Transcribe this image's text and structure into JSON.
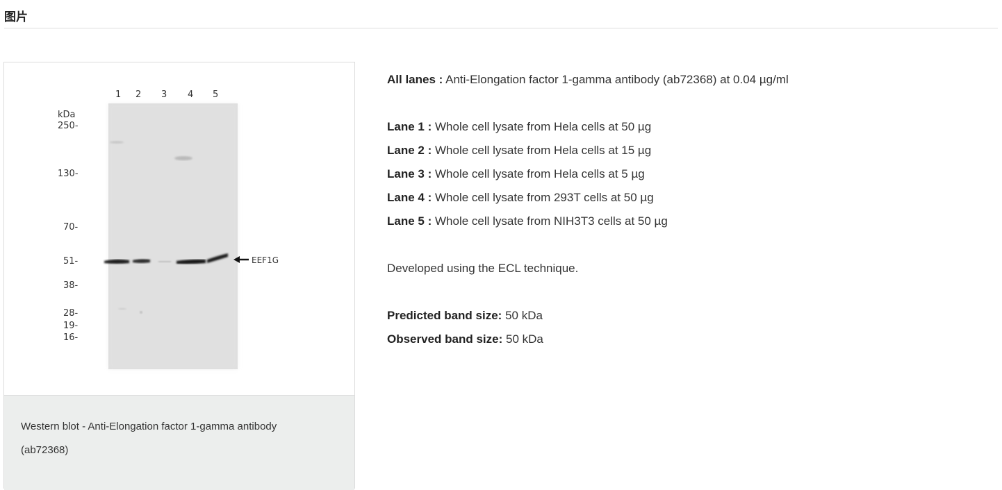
{
  "section": {
    "title": "图片"
  },
  "figure": {
    "lane_numbers": [
      "1",
      "2",
      "3",
      "4",
      "5"
    ],
    "unit_label": "kDa",
    "markers": [
      "250",
      "130",
      "70",
      "51",
      "38",
      "28",
      "19",
      "16"
    ],
    "band_label": "EEF1G",
    "caption": "Western blot - Anti-Elongation factor 1-gamma antibody (ab72368)"
  },
  "info": {
    "all_lanes_label": "All lanes :",
    "all_lanes_text": "Anti-Elongation factor 1-gamma antibody (ab72368) at 0.04 µg/ml",
    "lanes": [
      {
        "label": "Lane 1 :",
        "text": "Whole cell lysate from Hela cells at 50 µg"
      },
      {
        "label": "Lane 2 :",
        "text": "Whole cell lysate from Hela cells at 15 µg"
      },
      {
        "label": "Lane 3 :",
        "text": "Whole cell lysate from Hela cells at 5 µg"
      },
      {
        "label": "Lane 4 :",
        "text": "Whole cell lysate from 293T cells at 50 µg"
      },
      {
        "label": "Lane 5 :",
        "text": "Whole cell lysate from NIH3T3 cells at 50 µg"
      }
    ],
    "developed": "Developed using the ECL technique.",
    "predicted_label": "Predicted band size:",
    "predicted_value": "50 kDa",
    "observed_label": "Observed band size:",
    "observed_value": "50 kDa"
  }
}
